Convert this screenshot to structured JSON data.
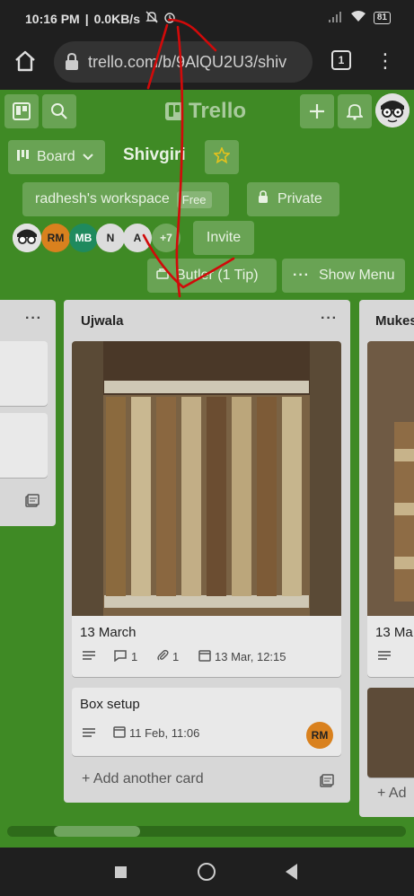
{
  "status": {
    "time": "10:16 PM",
    "speed": "0.0KB/s",
    "battery": "81"
  },
  "browser": {
    "url": "trello.com/b/9AlQU2U3/shiv",
    "tab_count": "1"
  },
  "header": {
    "logo": "Trello"
  },
  "board": {
    "view_label": "Board",
    "name": "Shivgiri",
    "workspace": "radhesh's workspace",
    "workspace_badge": "Free",
    "visibility": "Private",
    "extra_members": "+7",
    "invite_label": "Invite",
    "butler_label": "Butler (1 Tip)",
    "show_menu_label": "Show Menu",
    "members": [
      {
        "initials": "RM",
        "color": "#d9811e"
      },
      {
        "initials": "MB",
        "color": "#1f8a5e"
      },
      {
        "initials": "N",
        "color": "#dcdcdc"
      },
      {
        "initials": "A",
        "color": "#dcdcdc"
      }
    ]
  },
  "lists": {
    "main": {
      "title": "Ujwala",
      "cards": [
        {
          "title": "13 March",
          "comments": "1",
          "attachments": "1",
          "date": "13 Mar, 12:15"
        },
        {
          "title": "Box setup",
          "date": "11 Feb, 11:06",
          "member": "RM"
        }
      ],
      "add_card": "Add another card"
    },
    "right": {
      "title": "Mukes",
      "card_title": "13 Ma",
      "add_card": "Ad"
    }
  },
  "colors": {
    "board_bg": "#3f8a25",
    "annotation": "#d10a0a"
  }
}
